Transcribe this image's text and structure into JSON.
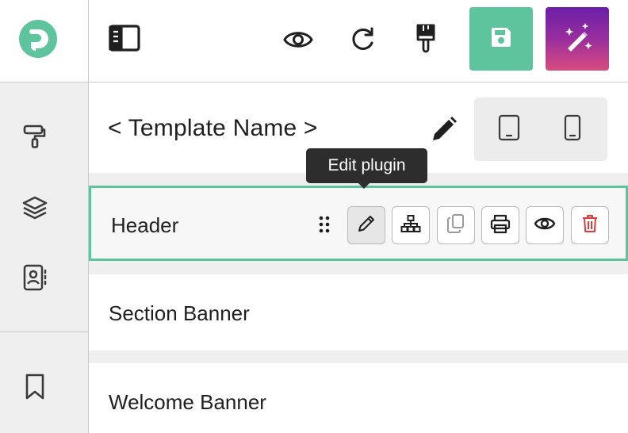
{
  "app": {
    "logo_icon": "dreamer-d-logo",
    "accent_color": "#5ec49e",
    "danger_color": "#e03b3b"
  },
  "rail": {
    "items": [
      {
        "icon": "paint-roller-icon",
        "label": "Styles"
      },
      {
        "icon": "layers-icon",
        "label": "Layers"
      },
      {
        "icon": "contact-book-icon",
        "label": "Contacts"
      },
      {
        "icon": "bookmark-icon",
        "label": "Bookmarks"
      }
    ]
  },
  "toolbar": {
    "sidebar_toggle_icon": "sidebar-toggle-icon",
    "preview_icon": "eye-icon",
    "refresh_icon": "redo-icon",
    "brush_icon": "paint-brush-icon",
    "save_icon": "floppy-disk-icon",
    "save_color": "#5ec49e",
    "magic_icon": "magic-wand-icon"
  },
  "template": {
    "name": "< Template Name >",
    "edit_icon": "pencil-icon",
    "devices": [
      "tablet-icon",
      "mobile-icon"
    ]
  },
  "tooltip": {
    "text": "Edit plugin"
  },
  "plugins": [
    {
      "label": "Header",
      "selected": true
    },
    {
      "label": "Section Banner",
      "selected": false
    },
    {
      "label": "Welcome Banner",
      "selected": false
    }
  ],
  "plugin_actions": [
    {
      "icon": "pencil-icon",
      "label": "Edit plugin",
      "active": true
    },
    {
      "icon": "sitemap-icon",
      "label": "Structure",
      "active": false
    },
    {
      "icon": "copy-icon",
      "label": "Duplicate",
      "active": false
    },
    {
      "icon": "print-icon",
      "label": "Print",
      "active": false
    },
    {
      "icon": "eye-icon",
      "label": "Visibility",
      "active": false
    },
    {
      "icon": "trash-icon",
      "label": "Delete",
      "active": false
    }
  ]
}
